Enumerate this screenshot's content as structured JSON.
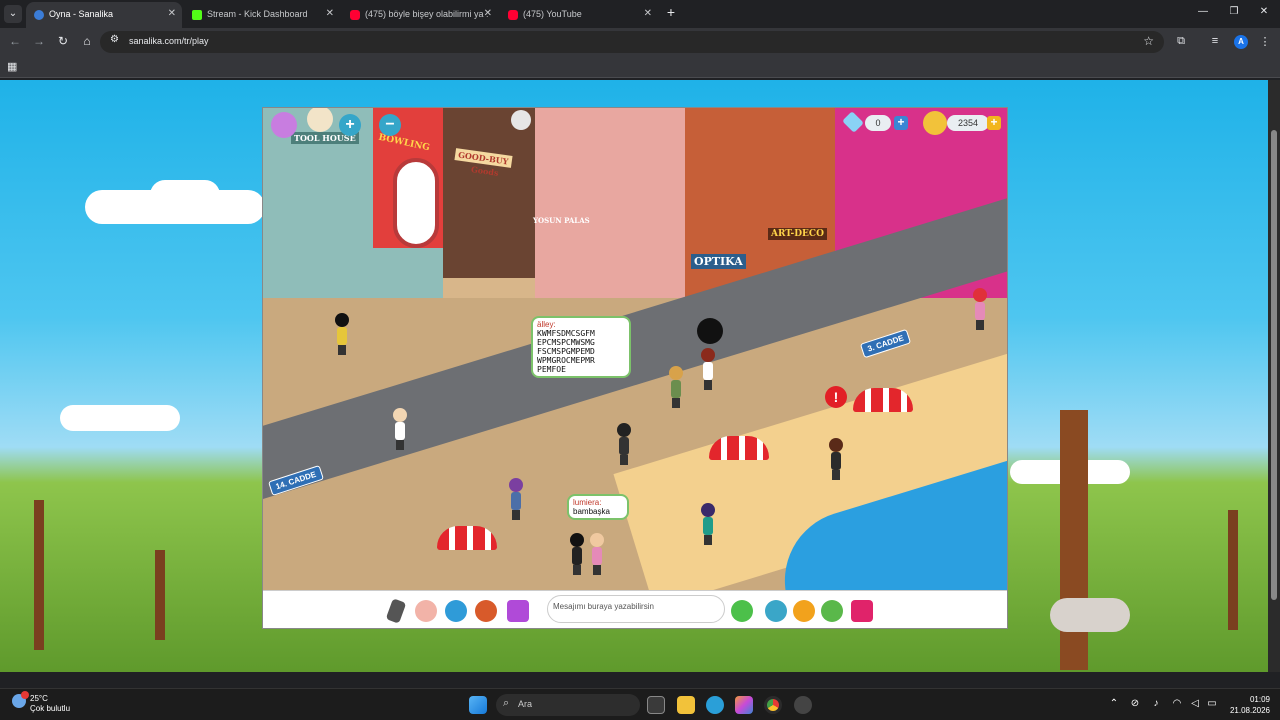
{
  "browser": {
    "tabs": [
      {
        "title": "Oyna - Sanalika",
        "active": true,
        "favicon_color": "#3b7dd8"
      },
      {
        "title": "Stream - Kick Dashboard",
        "active": false,
        "favicon_color": "#53fc18"
      },
      {
        "title": "(475) böyle bişey olabilirmi ya :(",
        "active": false,
        "favicon_color": "#ff0033"
      },
      {
        "title": "(475) YouTube",
        "active": false,
        "favicon_color": "#ff0033"
      }
    ],
    "url": "sanalika.com/tr/play",
    "profile_initial": "A"
  },
  "game": {
    "hud": {
      "diamonds": "0",
      "coins": "2354"
    },
    "chat_input_placeholder": "Mesajımı buraya yazabilirsin",
    "speech_bubbles": [
      {
        "speaker": "älley:",
        "text": "KWMFSDMCSGFM EPCMSPCMWSMG FSCMSPGMPEMD WPMGROCMEPMR PEMFOE"
      },
      {
        "speaker": "lumiera:",
        "text": "bambaşka"
      }
    ],
    "shop_signs": {
      "bowling": "BOWLING",
      "goodbuy_line1": "GOOD-BUY",
      "goodbuy_line2": "Goods",
      "optika": "OPTIKA",
      "artdeco": "ART-DECO",
      "toolhouse": "TOOL HOUSE",
      "yosun": "YOSUN PALAS"
    },
    "street_signs": {
      "cadde3": "3. CADDE",
      "cadde14": "14. CADDE"
    }
  },
  "taskbar": {
    "weather_temp": "25°C",
    "weather_desc": "Çok bulutlu",
    "search_label": "Ara",
    "time": "01:09",
    "date": "21.08.2026"
  }
}
